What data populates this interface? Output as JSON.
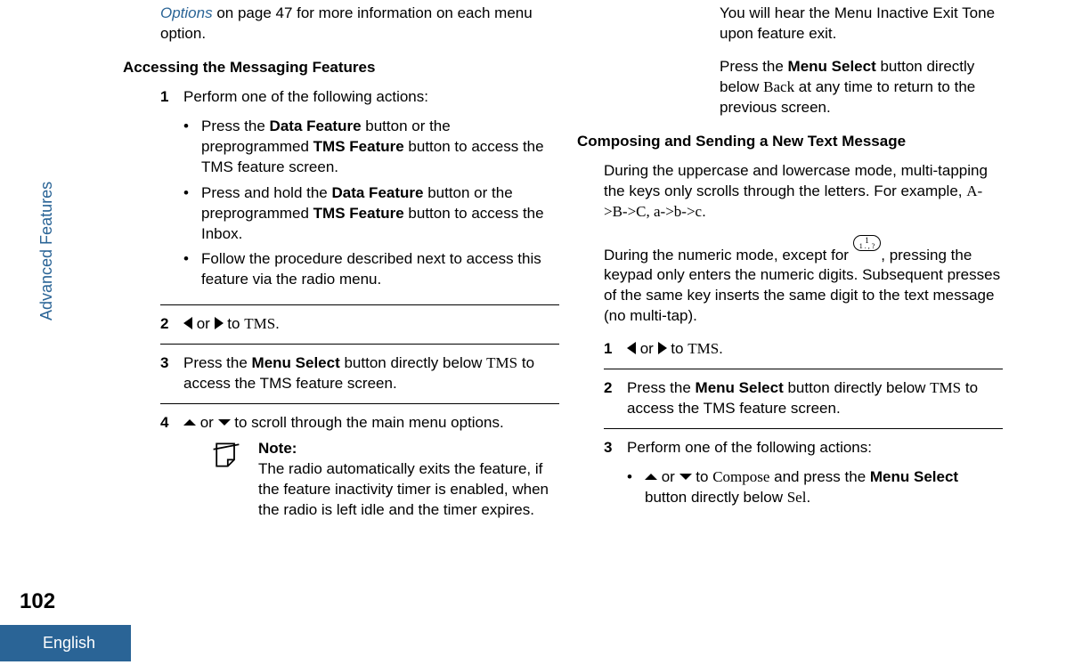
{
  "left": {
    "topline_pre": "Options",
    "topline_rest": " on page 47 for more information on each menu option.",
    "heading1": "Accessing the Messaging Features",
    "step1": "Perform one of the following actions:",
    "b1a_pre": "Press the ",
    "b1a_bold1": "Data Feature",
    "b1a_mid": " button or the preprogrammed ",
    "b1a_bold2": "TMS Feature",
    "b1a_post": " button to access the TMS feature screen.",
    "b1b_pre": "Press and hold the ",
    "b1b_bold1": "Data Feature",
    "b1b_mid": " button or the preprogrammed ",
    "b1b_bold2": "TMS Feature",
    "b1b_post": " button to access the Inbox.",
    "b1c": "Follow the procedure described next to access this feature via the radio menu.",
    "step2_or": " or ",
    "step2_to": " to ",
    "step2_tms": "TMS",
    "step2_dot": ".",
    "step3_pre": "Press the ",
    "step3_bold": "Menu Select",
    "step3_mid": " button directly below ",
    "step3_tms": "TMS",
    "step3_post": " to access the TMS feature screen.",
    "step4_or": " or ",
    "step4_post": " to scroll through the main menu options.",
    "note_label": "Note:",
    "note_body": "The radio automatically exits the feature, if the feature inactivity timer is enabled, when the radio is left idle and the timer expires."
  },
  "right": {
    "top1": "You will hear the Menu Inactive Exit Tone upon feature exit.",
    "top2_pre": "Press the ",
    "top2_bold": "Menu Select",
    "top2_mid": " button directly below ",
    "top2_back": "Back",
    "top2_post": " at any time to return to the previous screen.",
    "heading": "Composing and Sending a New Text Message",
    "p1_pre": "During the uppercase and lowercase mode, multi-tapping the keys only scrolls through the letters. For example, ",
    "p1_seq": "A->B->C, a->b->c",
    "p1_dot": ".",
    "p2_pre": "During the numeric mode, except for ",
    "key_label": "1 . , ?",
    "p2_post": ", pressing the keypad only enters the numeric digits. Subsequent presses of the same key inserts the same digit to the text message (no multi-tap).",
    "s1_or": " or ",
    "s1_to": " to ",
    "s1_tms": "TMS",
    "s1_dot": ".",
    "s2_pre": "Press the ",
    "s2_bold": "Menu Select",
    "s2_mid": " button directly below ",
    "s2_tms": "TMS",
    "s2_post": " to access the TMS feature screen.",
    "s3": "Perform one of the following actions:",
    "s3b_or": " or ",
    "s3b_to": " to ",
    "s3b_compose": "Compose",
    "s3b_mid": " and press the ",
    "s3b_bold": "Menu Select",
    "s3b_mid2": " button directly below ",
    "s3b_sel": "Sel",
    "s3b_dot": "."
  },
  "meta": {
    "section": "Advanced Features",
    "page_number": "102",
    "language": "English"
  }
}
